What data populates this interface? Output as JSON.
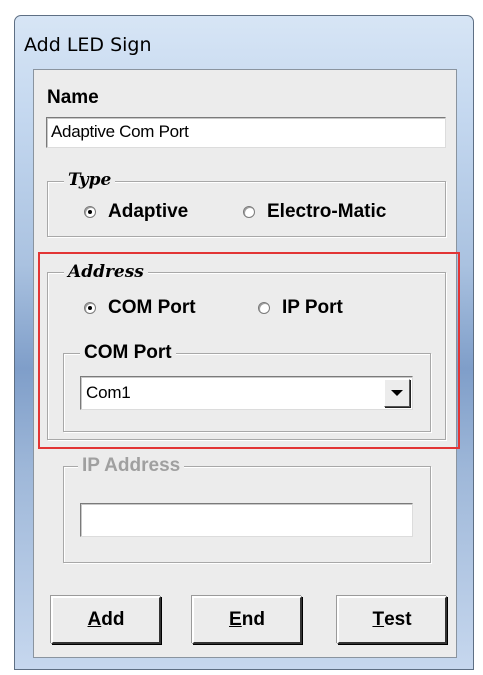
{
  "window": {
    "title": "Add LED Sign"
  },
  "name_field": {
    "label": "Name",
    "value": "Adaptive Com Port"
  },
  "type_group": {
    "legend": "Type",
    "options": [
      {
        "label": "Adaptive",
        "selected": true
      },
      {
        "label": "Electro-Matic",
        "selected": false
      }
    ]
  },
  "address_group": {
    "legend": "Address",
    "options": [
      {
        "label": "COM Port",
        "selected": true
      },
      {
        "label": "IP Port",
        "selected": false
      }
    ],
    "com_port": {
      "legend": "COM Port",
      "selected_value": "Com1"
    },
    "ip_address": {
      "legend": "IP Address",
      "value": "",
      "disabled": true
    }
  },
  "buttons": {
    "add": {
      "mnemonic": "A",
      "rest": "dd"
    },
    "end": {
      "mnemonic": "E",
      "rest": "nd"
    },
    "test": {
      "mnemonic": "T",
      "rest": "est"
    }
  },
  "colors": {
    "highlight": "#e23535",
    "dialog_bg": "#ececec"
  }
}
